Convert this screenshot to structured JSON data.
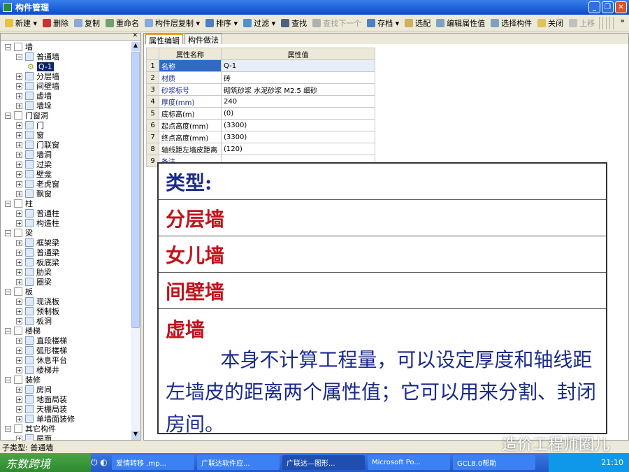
{
  "window": {
    "title": "构件管理"
  },
  "toolbar": [
    {
      "label": "新建 ▾",
      "icon": "new-icon",
      "color": "#e8c040"
    },
    {
      "label": "删除",
      "icon": "delete-icon",
      "color": "#d03030"
    },
    {
      "label": "复制",
      "icon": "copy-icon",
      "color": "#8aa8d8"
    },
    {
      "label": "重命名",
      "icon": "rename-icon",
      "color": "#70a070"
    },
    {
      "label": "构件层复制 ▾",
      "icon": "layer-copy-icon",
      "color": "#8aa8d8"
    },
    {
      "label": "排序 ▾",
      "icon": "sort-icon",
      "color": "#5080c0"
    },
    {
      "label": "过滤 ▾",
      "icon": "filter-icon",
      "color": "#5090d0"
    },
    {
      "label": "查找",
      "icon": "find-icon",
      "color": "#506080"
    },
    {
      "label": "查找下一个",
      "icon": "find-next-icon",
      "color": "#b0b0b0",
      "disabled": true
    },
    {
      "label": "存档 ▾",
      "icon": "archive-icon",
      "color": "#5080c0"
    },
    {
      "label": "选配",
      "icon": "match-icon",
      "color": "#d0b060"
    },
    {
      "label": "编辑属性值",
      "icon": "edit-props-icon",
      "color": "#80a0c0"
    },
    {
      "label": "选择构件",
      "icon": "select-icon",
      "color": "#80a0c0"
    },
    {
      "label": "关闭",
      "icon": "close-folder-icon",
      "color": "#e0c060"
    },
    {
      "label": "上移",
      "icon": "move-up-icon",
      "color": "#c0c0c0",
      "disabled": true
    }
  ],
  "tree": [
    {
      "label": "墙",
      "level": 0,
      "exp": "−"
    },
    {
      "label": "普通墙",
      "level": 1,
      "exp": "−"
    },
    {
      "label": "Q-1",
      "level": 2,
      "selected": true
    },
    {
      "label": "分层墙",
      "level": 1,
      "exp": "+"
    },
    {
      "label": "间壁墙",
      "level": 1,
      "exp": "+"
    },
    {
      "label": "虚墙",
      "level": 1,
      "exp": "+"
    },
    {
      "label": "墙垛",
      "level": 1,
      "exp": "+"
    },
    {
      "label": "门窗洞",
      "level": 0,
      "exp": "−"
    },
    {
      "label": "门",
      "level": 1,
      "exp": "+"
    },
    {
      "label": "窗",
      "level": 1,
      "exp": "+"
    },
    {
      "label": "门联窗",
      "level": 1,
      "exp": "+"
    },
    {
      "label": "墙洞",
      "level": 1,
      "exp": "+"
    },
    {
      "label": "过梁",
      "level": 1,
      "exp": "+"
    },
    {
      "label": "壁龛",
      "level": 1,
      "exp": "+"
    },
    {
      "label": "老虎窗",
      "level": 1,
      "exp": "+"
    },
    {
      "label": "飘窗",
      "level": 1,
      "exp": "+"
    },
    {
      "label": "柱",
      "level": 0,
      "exp": "−"
    },
    {
      "label": "普通柱",
      "level": 1,
      "exp": "+"
    },
    {
      "label": "构造柱",
      "level": 1,
      "exp": "+"
    },
    {
      "label": "梁",
      "level": 0,
      "exp": "−"
    },
    {
      "label": "框架梁",
      "level": 1,
      "exp": "+"
    },
    {
      "label": "普通梁",
      "level": 1,
      "exp": "+"
    },
    {
      "label": "板底梁",
      "level": 1,
      "exp": "+"
    },
    {
      "label": "肋梁",
      "level": 1,
      "exp": "+"
    },
    {
      "label": "圈梁",
      "level": 1,
      "exp": "+"
    },
    {
      "label": "板",
      "level": 0,
      "exp": "−"
    },
    {
      "label": "现浇板",
      "level": 1,
      "exp": "+"
    },
    {
      "label": "预制板",
      "level": 1,
      "exp": "+"
    },
    {
      "label": "板洞",
      "level": 1,
      "exp": "+"
    },
    {
      "label": "楼梯",
      "level": 0,
      "exp": "−"
    },
    {
      "label": "直段楼梯",
      "level": 1,
      "exp": "+"
    },
    {
      "label": "弧形楼梯",
      "level": 1,
      "exp": "+"
    },
    {
      "label": "休息平台",
      "level": 1,
      "exp": "+"
    },
    {
      "label": "楼梯井",
      "level": 1,
      "exp": "+"
    },
    {
      "label": "装修",
      "level": 0,
      "exp": "−"
    },
    {
      "label": "房间",
      "level": 1,
      "exp": "+"
    },
    {
      "label": "地面局装",
      "level": 1,
      "exp": "+"
    },
    {
      "label": "天棚局装",
      "level": 1,
      "exp": "+"
    },
    {
      "label": "单墙面装修",
      "level": 1,
      "exp": "+"
    },
    {
      "label": "其它构件",
      "level": 0,
      "exp": "−"
    },
    {
      "label": "屋面",
      "level": 1,
      "exp": "+"
    }
  ],
  "tabs": [
    "属性编辑",
    "构件做法"
  ],
  "table": {
    "headers": [
      "属性名称",
      "属性值"
    ],
    "rows": [
      {
        "n": "1",
        "k": "名称",
        "v": "Q-1"
      },
      {
        "n": "2",
        "k": "材质",
        "v": "砖"
      },
      {
        "n": "3",
        "k": "砂浆标号",
        "v": "砌筑砂浆 水泥砂浆 M2.5 细砂"
      },
      {
        "n": "4",
        "k": "厚度(mm)",
        "v": "240"
      },
      {
        "n": "5",
        "k": "底标高(m)",
        "v": "(0)",
        "plain": true
      },
      {
        "n": "6",
        "k": "起点高度(mm)",
        "v": "(3300)",
        "plain": true
      },
      {
        "n": "7",
        "k": "终点高度(mm)",
        "v": "(3300)",
        "plain": true
      },
      {
        "n": "8",
        "k": "轴线距左墙皮距离",
        "v": "(120)",
        "plain": true
      },
      {
        "n": "9",
        "k": "备注",
        "v": ""
      }
    ]
  },
  "overlay": {
    "type_label": "类型:",
    "items": [
      "分层墙",
      "女儿墙",
      "间壁墙"
    ],
    "last_title": "虚墙",
    "description": "本身不计算工程量，可以设定厚度和轴线距左墙皮的距离两个属性值；它可以用来分割、封闭房间。"
  },
  "status": {
    "text": "子类型: 普通墙"
  },
  "watermark": "造价工程师圈儿",
  "taskbar": {
    "start": "东数跨境",
    "tasks": [
      "爱情转移 .mp...",
      "广联达软件应...",
      "广联达—图形...",
      "Microsoft Po...",
      "GCL8.0帮助"
    ],
    "active": 2,
    "clock": "21:10"
  }
}
